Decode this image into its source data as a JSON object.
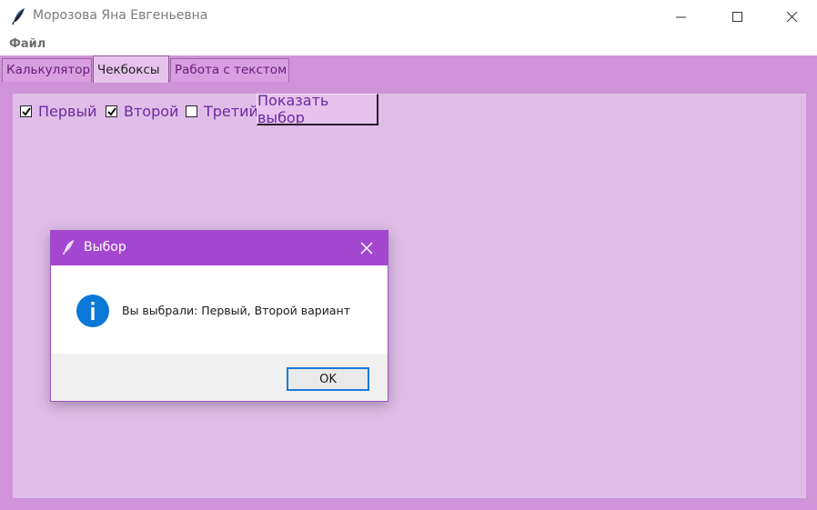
{
  "window": {
    "title": "Морозова Яна Евгеньевна",
    "icon": "feather-icon"
  },
  "menu": {
    "file": "Файл"
  },
  "tabs": [
    {
      "label": "Калькулятор",
      "active": false
    },
    {
      "label": "Чекбоксы",
      "active": true
    },
    {
      "label": "Работа с текстом",
      "active": false
    }
  ],
  "checkboxes": [
    {
      "label": "Первый",
      "checked": true
    },
    {
      "label": "Второй",
      "checked": true
    },
    {
      "label": "Третий",
      "checked": false
    }
  ],
  "show_button": "Показать выбор",
  "dialog": {
    "title": "Выбор",
    "message": "Вы выбрали: Первый, Второй вариант",
    "icon": "info-icon",
    "ok": "OK"
  },
  "colors": {
    "notebook_bg": "#cf93d8",
    "page_bg": "#e0bde8",
    "dialog_title_bg": "#a347d1",
    "label_text": "#6a2aa0",
    "info_blue": "#0a78d7"
  }
}
